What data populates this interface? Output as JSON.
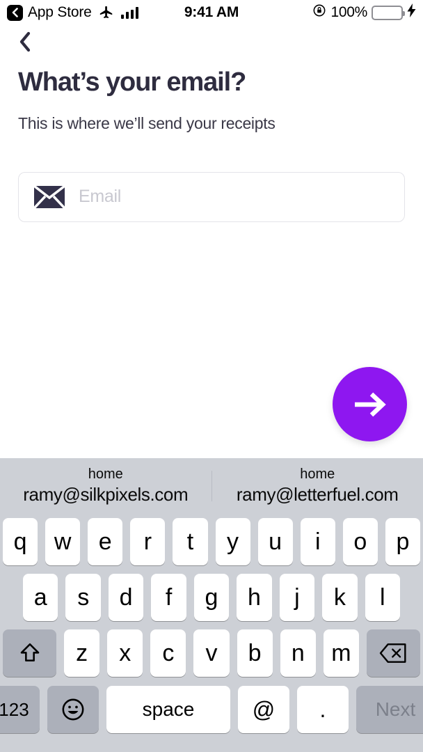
{
  "status_bar": {
    "back_badge_icon": "chevron-left-icon",
    "app_name": "App Store",
    "airplane_icon": "airplane-mode-icon",
    "signal_icon": "signal-bars-icon",
    "time": "9:41 AM",
    "rotation_lock_icon": "rotation-lock-icon",
    "battery_percent": "100%",
    "battery_icon": "battery-icon",
    "charging_icon": "lightning-bolt-icon",
    "battery_color": "#4CD964"
  },
  "screen": {
    "back_button_icon": "chevron-left-icon",
    "title": "What’s your email?",
    "subtitle": "This is where we’ll send your receipts",
    "title_color": "#2E2C3F"
  },
  "email_input": {
    "icon": "envelope-icon",
    "value": "",
    "placeholder": "Email"
  },
  "next_fab": {
    "icon": "arrow-right-icon",
    "color": "#8E17F0"
  },
  "keyboard": {
    "background_color": "#CDD0D6",
    "suggestions": [
      {
        "label": "home",
        "value": "ramy@silkpixels.com"
      },
      {
        "label": "home",
        "value": "ramy@letterfuel.com"
      }
    ],
    "row1": [
      "q",
      "w",
      "e",
      "r",
      "t",
      "y",
      "u",
      "i",
      "o",
      "p"
    ],
    "row2": [
      "a",
      "s",
      "d",
      "f",
      "g",
      "h",
      "j",
      "k",
      "l"
    ],
    "row3": [
      "z",
      "x",
      "c",
      "v",
      "b",
      "n",
      "m"
    ],
    "shift_key_icon": "shift-arrow-icon",
    "backspace_key_icon": "backspace-delete-icon",
    "numbers_key": "123",
    "emoji_key_icon": "smiley-face-icon",
    "space_key": "space",
    "at_key": "@",
    "period_key": ".",
    "next_key": "Next"
  }
}
